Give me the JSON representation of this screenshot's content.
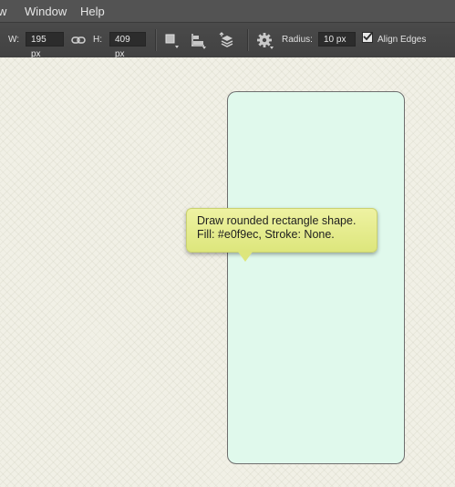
{
  "menubar": {
    "items": [
      "w",
      "Window",
      "Help"
    ]
  },
  "options": {
    "width_label": "W:",
    "width_value": "195 px",
    "height_label": "H:",
    "height_value": "409 px",
    "radius_label": "Radius:",
    "radius_value": "10 px",
    "align_edges_label": "Align Edges",
    "align_edges_checked": true
  },
  "tooltip": {
    "line1": "Draw rounded rectangle shape.",
    "line2": "Fill: #e0f9ec, Stroke: None."
  },
  "colors": {
    "shape_fill": "#e0f9ec",
    "tooltip_bg": "#e6ec8f",
    "menubar_bg": "#535353",
    "optionsbar_bg": "#464646"
  }
}
